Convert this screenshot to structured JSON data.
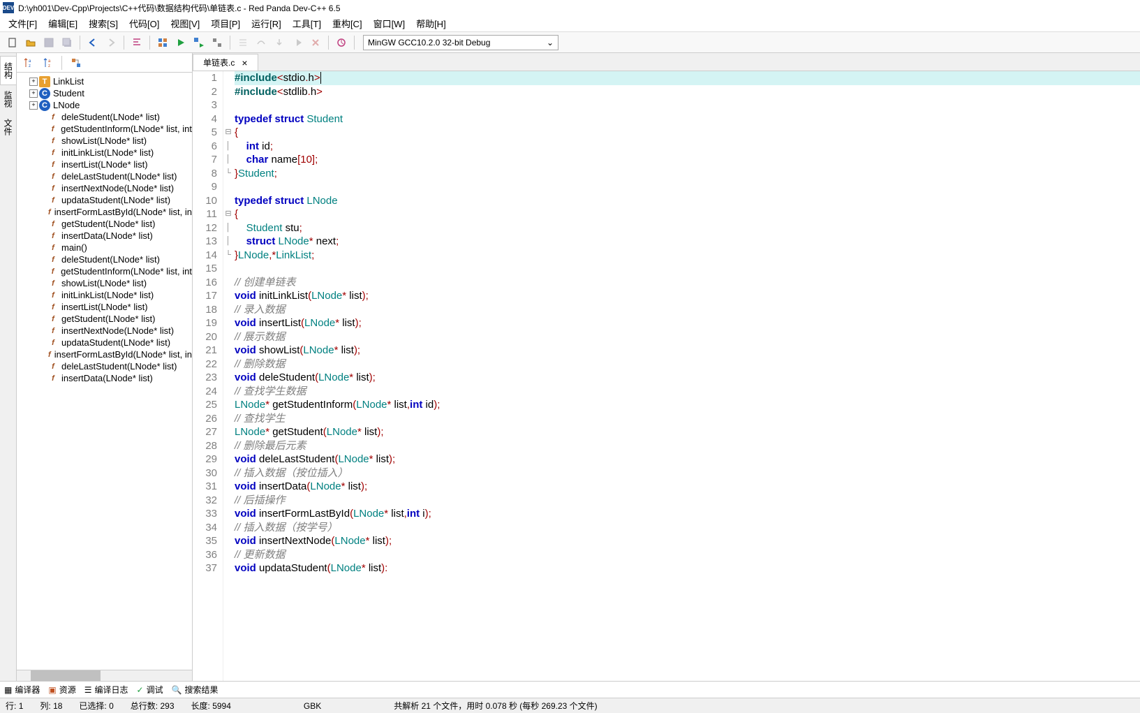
{
  "title": "D:\\yh001\\Dev-Cpp\\Projects\\C++代码\\数据结构代码\\单链表.c - Red Panda Dev-C++ 6.5",
  "menu": [
    "文件[F]",
    "编辑[E]",
    "搜索[S]",
    "代码[O]",
    "视图[V]",
    "项目[P]",
    "运行[R]",
    "工具[T]",
    "重构[C]",
    "窗口[W]",
    "帮助[H]"
  ],
  "compiler": "MinGW GCC10.2.0 32-bit Debug",
  "left_tabs": [
    "结构",
    "监视",
    "文件"
  ],
  "tree": {
    "roots": [
      {
        "icon": "T",
        "label": "LinkList",
        "expand": "+"
      },
      {
        "icon": "C",
        "label": "Student",
        "expand": "+"
      },
      {
        "icon": "C",
        "label": "LNode",
        "expand": "+"
      }
    ],
    "funcs": [
      "deleStudent(LNode* list)",
      "getStudentInform(LNode* list, int",
      "showList(LNode* list)",
      "initLinkList(LNode* list)",
      "insertList(LNode* list)",
      "deleLastStudent(LNode* list)",
      "insertNextNode(LNode* list)",
      "updataStudent(LNode* list)",
      "insertFormLastById(LNode* list, in",
      "getStudent(LNode* list)",
      "insertData(LNode* list)",
      "main()",
      "deleStudent(LNode* list)",
      "getStudentInform(LNode* list, int",
      "showList(LNode* list)",
      "initLinkList(LNode* list)",
      "insertList(LNode* list)",
      "getStudent(LNode* list)",
      "insertNextNode(LNode* list)",
      "updataStudent(LNode* list)",
      "insertFormLastById(LNode* list, in",
      "deleLastStudent(LNode* list)",
      "insertData(LNode* list)"
    ]
  },
  "tab_name": "单链表.c",
  "code_lines": 37,
  "bottom_tabs": [
    "编译器",
    "资源",
    "编译日志",
    "调试",
    "搜索结果"
  ],
  "status": {
    "row": "行:",
    "row_v": "1",
    "col": "列:",
    "col_v": "18",
    "sel": "已选择:",
    "sel_v": "0",
    "total": "总行数:",
    "total_v": "293",
    "len": "长度:",
    "len_v": "5994",
    "enc": "GBK",
    "msg": "共解析 21 个文件，用时 0.078 秒 (每秒 269.23 个文件)"
  }
}
